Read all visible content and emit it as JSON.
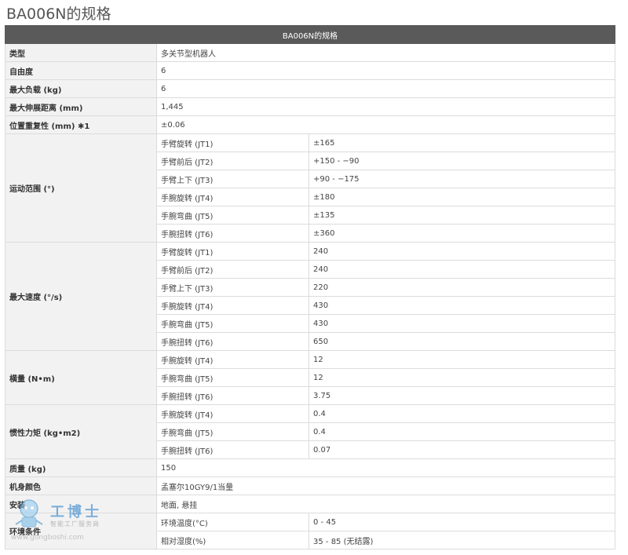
{
  "page_title": "BA006N的规格",
  "table_header": "BA006N的规格",
  "rows": [
    {
      "param": "类型",
      "value": "多关节型机器人"
    },
    {
      "param": "自由度",
      "value": "6"
    },
    {
      "param": "最大负载 (kg)",
      "value": "6"
    },
    {
      "param": "最大伸展距离 (mm)",
      "value": "1,445"
    },
    {
      "param": "位置重复性 (mm) ✱1",
      "value": "±0.06"
    }
  ],
  "groups": [
    {
      "param": "运动范围 (°)",
      "items": [
        {
          "axis": "手臂旋转 (JT1)",
          "value": "±165"
        },
        {
          "axis": "手臂前后 (JT2)",
          "value": "+150 - −90"
        },
        {
          "axis": "手臂上下 (JT3)",
          "value": "+90 - −175"
        },
        {
          "axis": "手腕旋转 (JT4)",
          "value": "±180"
        },
        {
          "axis": "手腕弯曲 (JT5)",
          "value": "±135"
        },
        {
          "axis": "手腕扭转 (JT6)",
          "value": "±360"
        }
      ]
    },
    {
      "param": "最大速度 (°/s)",
      "items": [
        {
          "axis": "手臂旋转 (JT1)",
          "value": "240"
        },
        {
          "axis": "手臂前后 (JT2)",
          "value": "240"
        },
        {
          "axis": "手臂上下 (JT3)",
          "value": "220"
        },
        {
          "axis": "手腕旋转 (JT4)",
          "value": "430"
        },
        {
          "axis": "手腕弯曲 (JT5)",
          "value": "430"
        },
        {
          "axis": "手腕扭转 (JT6)",
          "value": "650"
        }
      ]
    },
    {
      "param": "横量 (N•m)",
      "items": [
        {
          "axis": "手腕旋转 (JT4)",
          "value": "12"
        },
        {
          "axis": "手腕弯曲 (JT5)",
          "value": "12"
        },
        {
          "axis": "手腕扭转 (JT6)",
          "value": "3.75"
        }
      ]
    },
    {
      "param": "惯性力矩 (kg•m2)",
      "items": [
        {
          "axis": "手腕旋转 (JT4)",
          "value": "0.4"
        },
        {
          "axis": "手腕弯曲 (JT5)",
          "value": "0.4"
        },
        {
          "axis": "手腕扭转 (JT6)",
          "value": "0.07"
        }
      ]
    }
  ],
  "rows_after": [
    {
      "param": "质量 (kg)",
      "value": "150"
    },
    {
      "param": "机身颜色",
      "value": "孟塞尔10GY9/1当量"
    },
    {
      "param": "安装",
      "value": "地面, 悬挂"
    }
  ],
  "env_group": {
    "param": "环境条件",
    "items": [
      {
        "axis": "环境温度(°C)",
        "value": "0 - 45"
      },
      {
        "axis": "相对湿度(%)",
        "value": "35 - 85 (无结露)"
      }
    ]
  },
  "watermark": {
    "name": "工博士",
    "subtitle": "智能工厂服务商",
    "url": "www.gongboshi.com"
  }
}
